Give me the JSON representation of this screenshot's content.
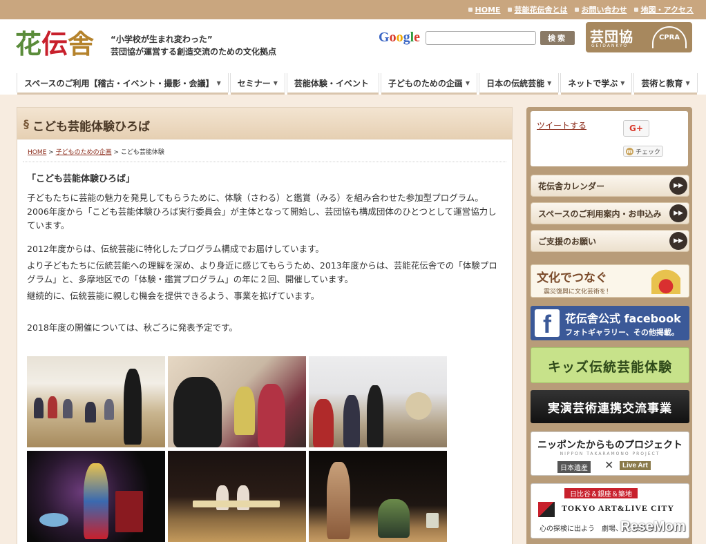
{
  "top_links": [
    "HOME",
    "芸能花伝舎とは",
    "お問い合わせ",
    "地図・アクセス"
  ],
  "logo": {
    "chars": [
      "花",
      "伝",
      "舎"
    ],
    "colors": [
      "#5a8c3a",
      "#c8202c",
      "#b5832c"
    ]
  },
  "tagline": {
    "line1": "“小学校が生まれ変わった”",
    "line2": "芸団協が運営する創造交流のための文化拠点"
  },
  "search": {
    "google": [
      "G",
      "o",
      "o",
      "g",
      "l",
      "e"
    ],
    "placeholder": "",
    "button": "検索"
  },
  "org_logo": {
    "name": "芸団協",
    "sub": "GEIDANKYO",
    "mark": "CPRA"
  },
  "nav": [
    {
      "label": "スペースのご利用【稽古・イベント・撮影・会議】",
      "caret": "▼"
    },
    {
      "label": "セミナー",
      "caret": "▼"
    },
    {
      "label": "芸能体験・イベント",
      "caret": ""
    },
    {
      "label": "子どものための企画",
      "caret": "▼"
    },
    {
      "label": "日本の伝統芸能",
      "caret": "▼"
    },
    {
      "label": "ネットで学ぶ",
      "caret": "▼"
    },
    {
      "label": "芸術と教育",
      "caret": "▼"
    }
  ],
  "page": {
    "mark": "§",
    "title": "こども芸能体験ひろば",
    "breadcrumb": {
      "home": "HOME",
      "sep": " > ",
      "parent": "子どものための企画",
      "current": "こども芸能体験"
    }
  },
  "content": {
    "heading": "「こども芸能体験ひろば」",
    "p1": "子どもたちに芸能の魅力を発見してもらうために、体験（さわる）と鑑賞（みる）を組み合わせた参加型プログラム。2006年度から「こども芸能体験ひろば実行委員会」が主体となって開始し、芸団協も構成団体のひとつとして運営協力しています。",
    "p2": "2012年度からは、伝統芸能に特化したプログラム構成でお届けしています。",
    "p3": "より子どもたちに伝統芸能への理解を深め、より身近に感じてもらうため、2013年度からは、芸能花伝舎での「体験プログラム」と、多摩地区での「体験・鑑賞プログラム」の年に２回、開催しています。",
    "p4": "継続的に、伝統芸能に親しむ機会を提供できるよう、事業を拡げています。",
    "p5": "2018年度の開催については、秋ごろに発表予定です。"
  },
  "sidebar": {
    "tweet": "ツイートする",
    "gplus": "G+",
    "mixi_m": "m",
    "mixi": "チェック",
    "buttons": [
      {
        "label": "花伝舎カレンダー"
      },
      {
        "label": "スペースのご利用案内・お申込み"
      },
      {
        "label": "ご支援のお願い"
      }
    ],
    "arrow": "▶▶",
    "banners": {
      "bunka": {
        "line1": "文化でつなぐ",
        "line2": "震災復興に文化芸術を！"
      },
      "facebook": {
        "f": "f",
        "line1": "花伝舎公式 facebook",
        "line2": "フォトギャラリー、その他掲載。"
      },
      "kids": {
        "line1": "キッズ伝統芸能体験"
      },
      "jitsuen": {
        "line1": "実演芸術連携交流事業"
      },
      "nippon": {
        "line1": "ニッポンたからものプロジェクト",
        "line2": "NIPPON TAKARAMONO PROJECT",
        "line3": "日本遺産",
        "cross": "✕",
        "line4": "Live Art"
      },
      "tokyo": {
        "line1": "日比谷＆銀座＆築地",
        "line2": "TOKYO ART&LIVE CITY",
        "line3": "心の探検に出よう　劇場、ギャラリー"
      }
    }
  },
  "watermark": "ReseMom"
}
